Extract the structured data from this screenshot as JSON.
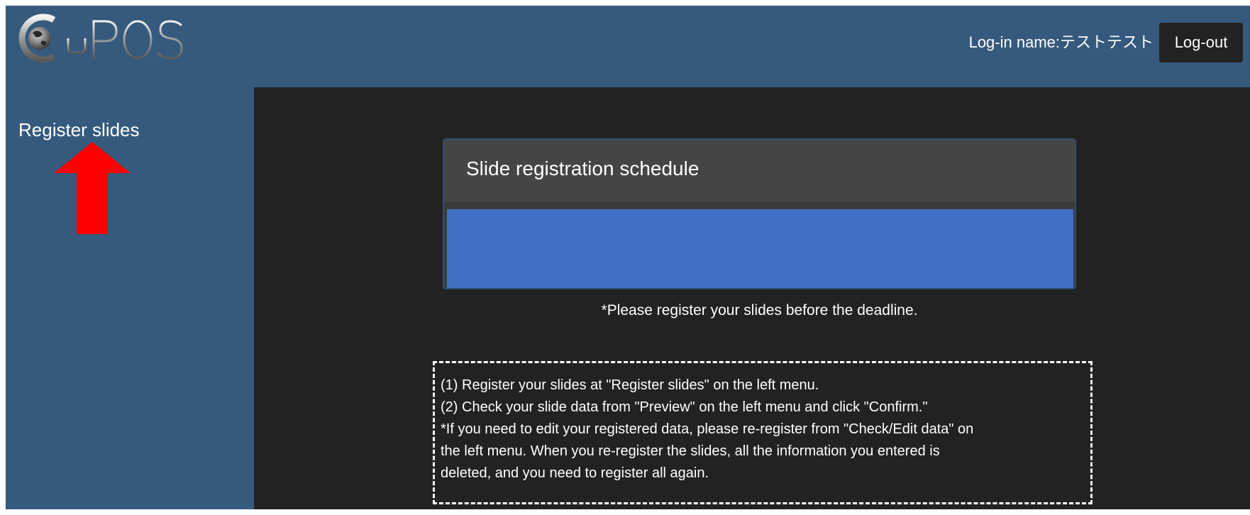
{
  "header": {
    "logo_text": "CyPOS",
    "login_label": "Log-in name:テストテスト",
    "logout_label": "Log-out"
  },
  "sidebar": {
    "items": [
      {
        "label": "Register slides"
      }
    ]
  },
  "main": {
    "schedule_title": "Slide registration schedule",
    "deadline_note": "*Please register your slides before the deadline.",
    "instructions": [
      "(1) Register your slides at \"Register slides\" on the left menu.",
      "(2) Check your slide data from \"Preview\" on the left menu and click \"Confirm.\"",
      "*If you need to edit your registered data, please re-register from \"Check/Edit data\" on",
      "the left menu. When you re-register the slides, all the information you entered is",
      "deleted, and you need to register all again."
    ]
  },
  "colors": {
    "header_bg": "#355a7d",
    "main_bg": "#222222",
    "schedule_bar": "#4370c4",
    "arrow": "#ff0000"
  }
}
